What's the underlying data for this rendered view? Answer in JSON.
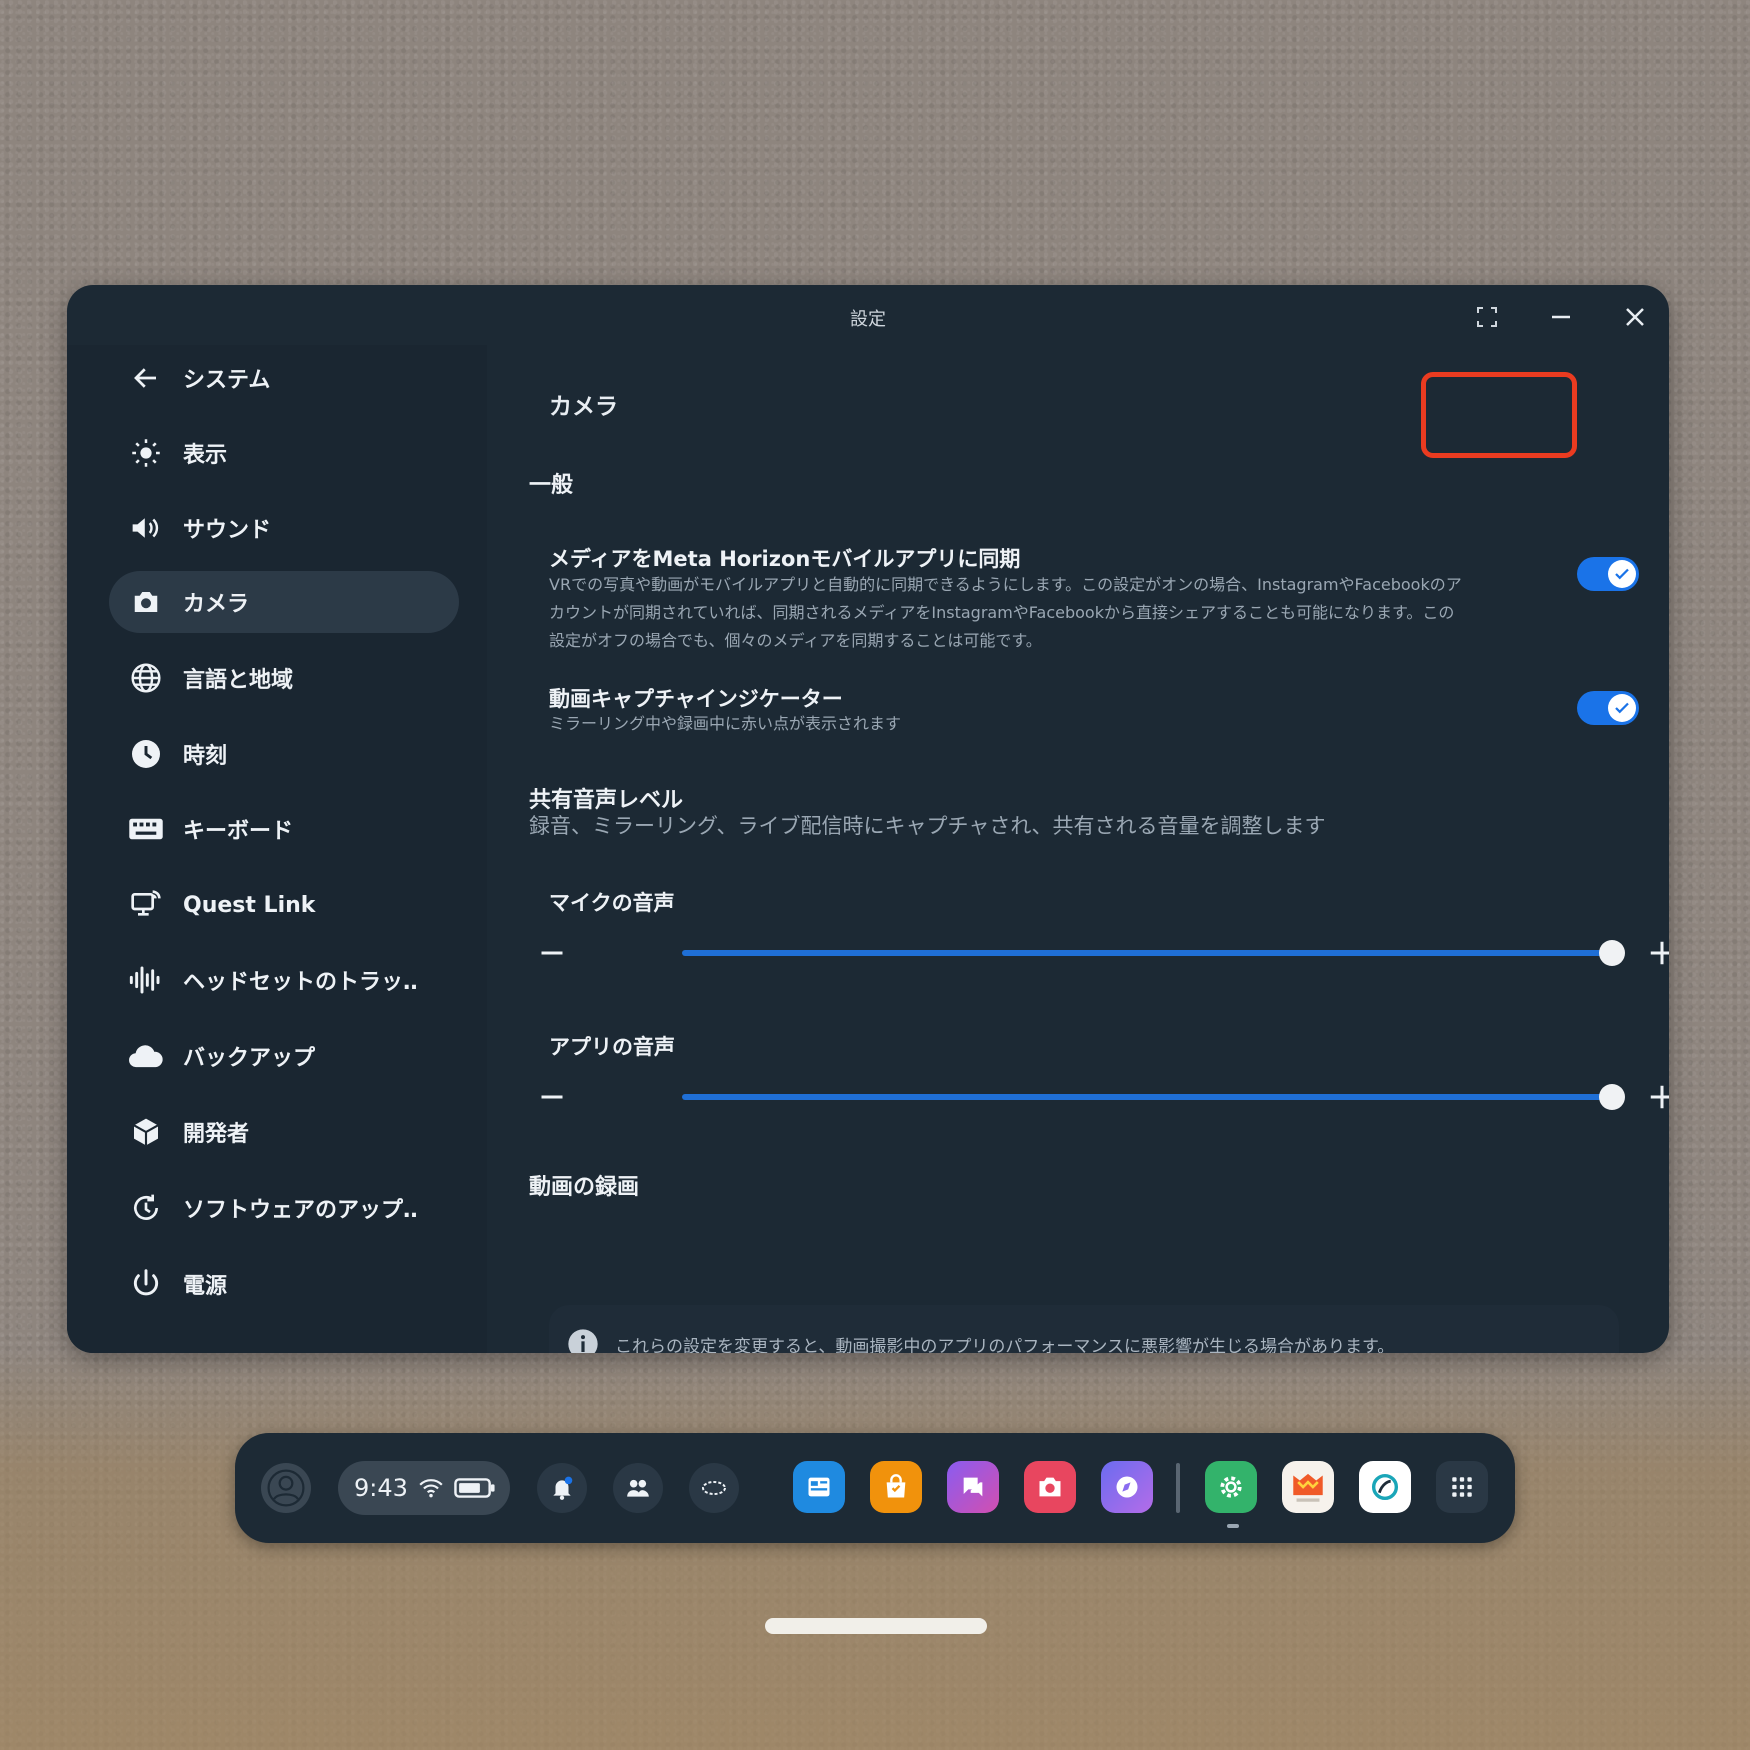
{
  "window": {
    "title": "設定"
  },
  "sidebar": {
    "items": [
      {
        "label": "システム"
      },
      {
        "label": "表示"
      },
      {
        "label": "サウンド"
      },
      {
        "label": "カメラ",
        "active": true
      },
      {
        "label": "言語と地域"
      },
      {
        "label": "時刻"
      },
      {
        "label": "キーボード"
      },
      {
        "label": "Quest Link"
      },
      {
        "label": "ヘッドセットのトラッ‥"
      },
      {
        "label": "バックアップ"
      },
      {
        "label": "開発者"
      },
      {
        "label": "ソフトウェアのアップ‥"
      },
      {
        "label": "電源"
      }
    ]
  },
  "main": {
    "page_title": "カメラ",
    "general": {
      "heading": "一般",
      "sync": {
        "title": "メディアをMeta Horizonモバイルアプリに同期",
        "desc1": "VRでの写真や動画がモバイルアプリと自動的に同期できるようにします。この設定がオンの場合、InstagramやFacebookのア",
        "desc2": "カウントが同期されていれば、同期されるメディアをInstagramやFacebookから直接シェアすることも可能になります。この",
        "desc3": "設定がオフの場合でも、個々のメディアを同期することは可能です。",
        "enabled": true
      },
      "capture_indicator": {
        "title": "動画キャプチャインジケーター",
        "desc": "ミラーリング中や録画中に赤い点が表示されます",
        "enabled": true
      }
    },
    "shared_audio": {
      "heading": "共有音声レベル",
      "desc": "録音、ミラーリング、ライブ配信時にキャプチャされ、共有される音量を調整します",
      "mic": {
        "label": "マイクの音声",
        "level": 1.0
      },
      "app": {
        "label": "アプリの音声",
        "level": 1.0
      }
    },
    "video_recording": {
      "heading": "動画の録画",
      "notice": "これらの設定を変更すると、動画撮影中のアプリのパフォーマンスに悪影響が生じる場合があります。"
    }
  },
  "taskbar": {
    "time": "9:43",
    "apps": [
      "browser-app",
      "store-app",
      "messenger-app",
      "camera-app",
      "explore-app",
      "settings-app",
      "sticker-app",
      "horizon-app",
      "app-library"
    ]
  },
  "colors": {
    "accent": "#1a73e8",
    "highlight": "#ea3b20",
    "window_bg": "#1c2934"
  }
}
